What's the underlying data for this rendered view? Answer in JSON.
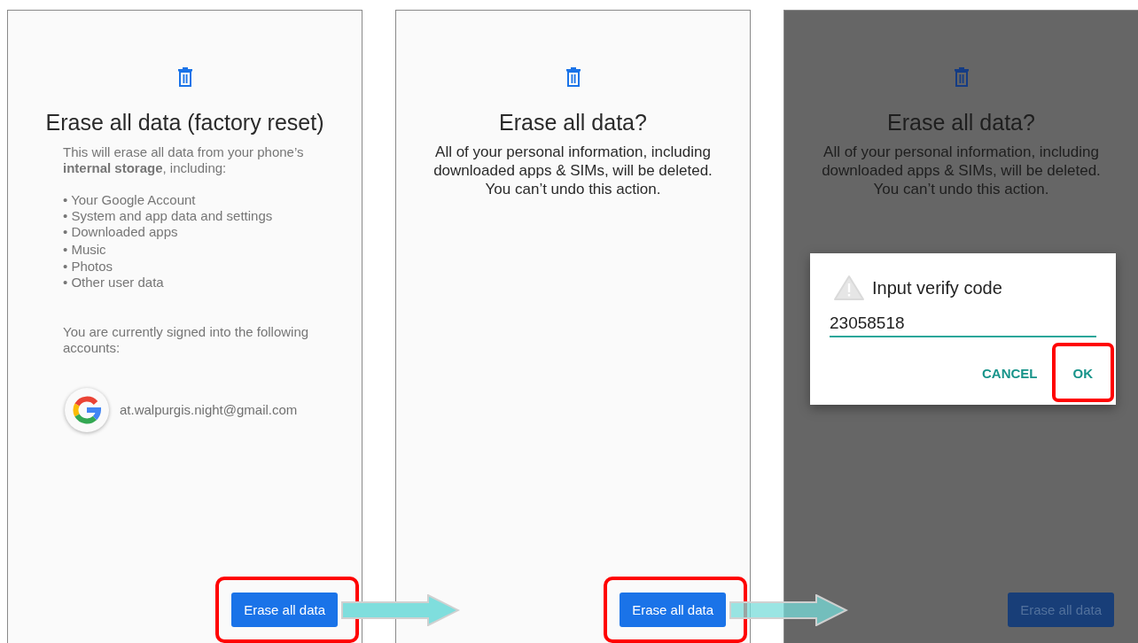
{
  "screens": [
    {
      "kind": "details",
      "dimmed": false,
      "title": "Erase all data (factory reset)",
      "intro": "This will erase all data from your phone’s **internal storage**, including:",
      "items": [
        "• Your Google Account",
        "• System and app data and settings",
        "• Downloaded apps",
        "• Music",
        "• Photos",
        "• Other user data"
      ],
      "accounts_note": "You are currently signed into the following accounts:",
      "account_email": "at.walpurgis.night@gmail.com",
      "button": {
        "label": "Erase all data",
        "highlighted": true
      }
    },
    {
      "kind": "confirm",
      "dimmed": false,
      "title": "Erase all data?",
      "message": "All of your personal information, including downloaded apps & SIMs, will be deleted. You can’t undo this action.",
      "button": {
        "label": "Erase all data",
        "highlighted": true
      }
    },
    {
      "kind": "confirm",
      "dimmed": true,
      "title": "Erase all data?",
      "message": "All of your personal information, including downloaded apps & SIMs, will be deleted. You can’t undo this action.",
      "button": {
        "label": "Erase all data",
        "highlighted": false
      },
      "dialog": {
        "title": "Input verify code",
        "value": "23058518",
        "buttons": [
          {
            "label": "CANCEL",
            "highlighted": false
          },
          {
            "label": "OK",
            "highlighted": true
          }
        ]
      }
    }
  ]
}
